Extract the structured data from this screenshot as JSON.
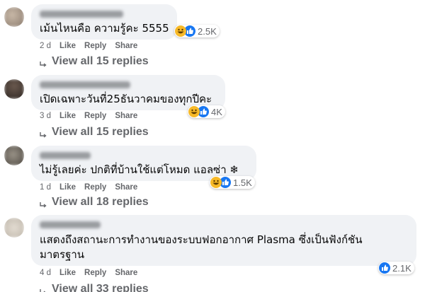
{
  "comments": [
    {
      "text": "เม้นไหนคือ ความรู้คะ 5555",
      "reactions": "2.5K",
      "reaction_icons": [
        "haha-icon",
        "like-icon"
      ],
      "time": "2 d",
      "like_label": "Like",
      "reply_label": "Reply",
      "share_label": "Share",
      "replies_label": "View all 15 replies"
    },
    {
      "text": "เปิดเฉพาะวันที่25ธันวาคมของทุกปีคะ",
      "reactions": "4K",
      "reaction_icons": [
        "haha-icon",
        "like-icon"
      ],
      "time": "3 d",
      "like_label": "Like",
      "reply_label": "Reply",
      "share_label": "Share",
      "replies_label": "View all 15 replies"
    },
    {
      "text": "ไม่รู้เลยค่ะ ปกติที่บ้านใช้แต่โหมด แอลซ่า ❄",
      "reactions": "1.5K",
      "reaction_icons": [
        "haha-icon",
        "like-icon"
      ],
      "time": "1 d",
      "like_label": "Like",
      "reply_label": "Reply",
      "share_label": "Share",
      "replies_label": "View all 18 replies"
    },
    {
      "text": "แสดงถึงสถานะการทำงานของระบบฟอกอากาศ Plasma ซึ่งเป็นฟังก์ชันมาตรฐาน",
      "reactions": "2.1K",
      "reaction_icons": [
        "like-icon"
      ],
      "time": "4 d",
      "like_label": "Like",
      "reply_label": "Reply",
      "share_label": "Share",
      "replies_label": "View all 33 replies"
    }
  ],
  "colors": {
    "bubble": "#f0f2f5",
    "meta": "#65676b",
    "like_blue": "#1877f2",
    "haha_yellow": "#f7b928"
  }
}
